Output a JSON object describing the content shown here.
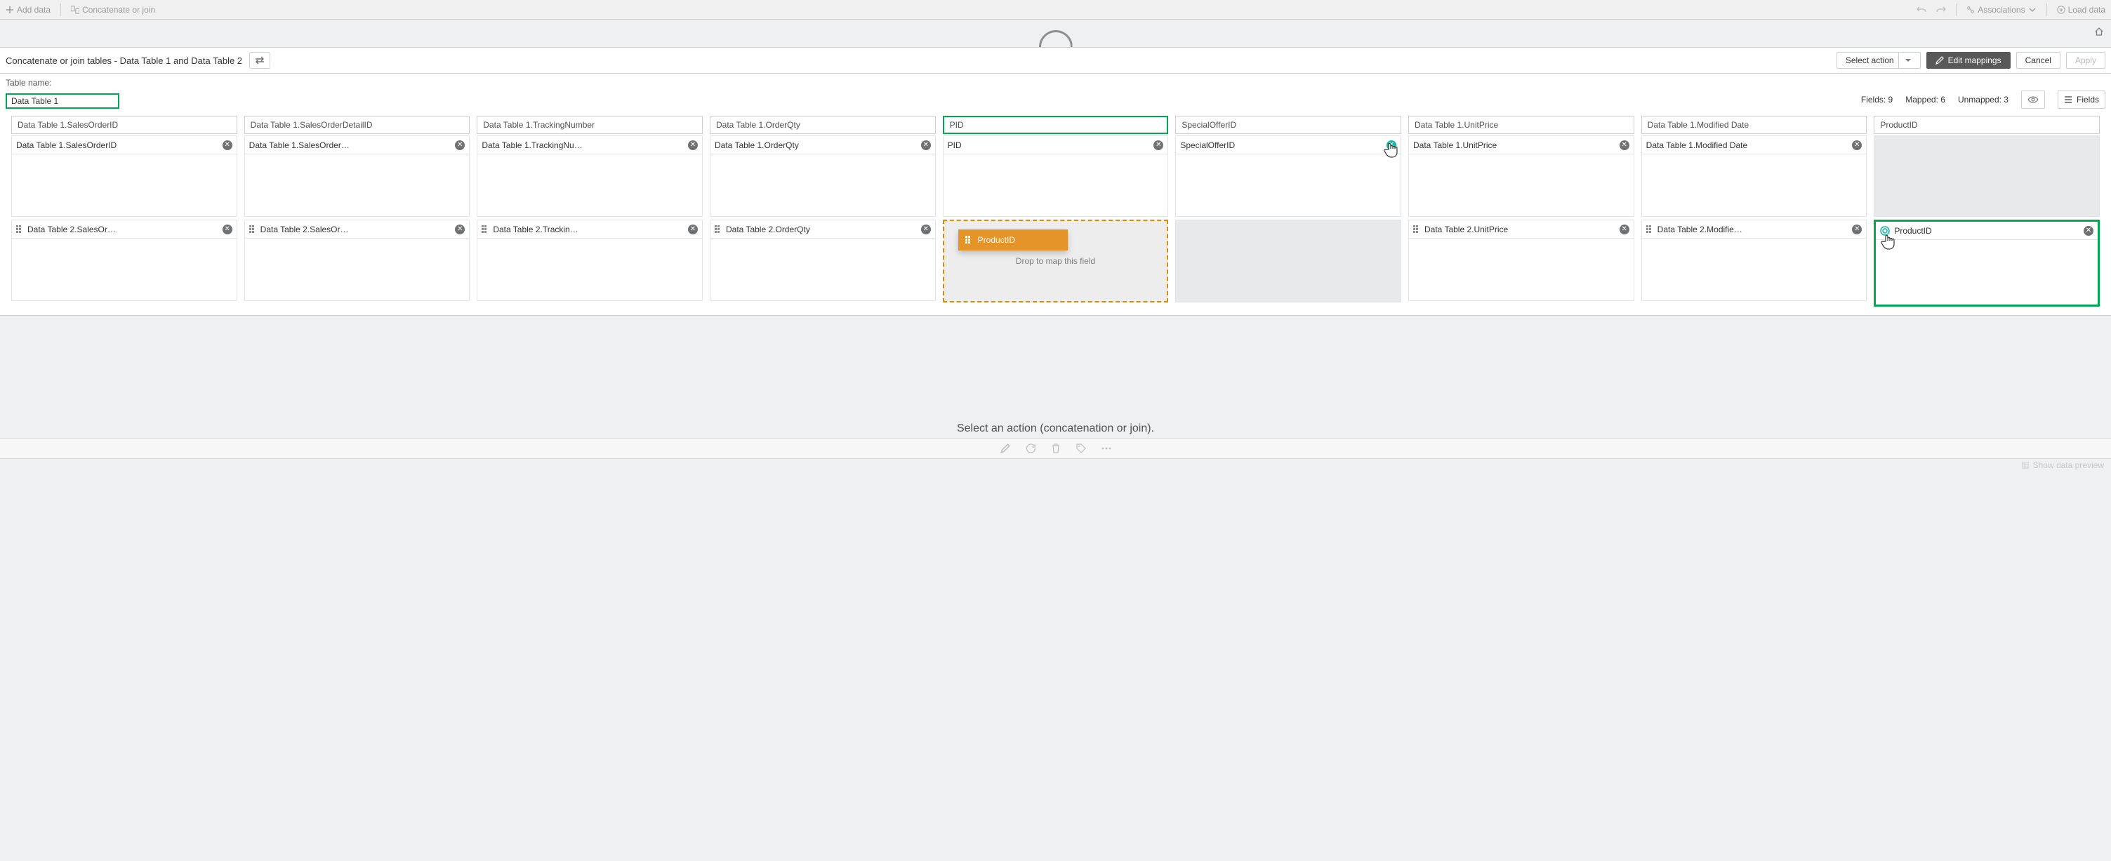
{
  "topbar": {
    "add_data": "Add data",
    "concat": "Concatenate or join",
    "associations": "Associations",
    "load": "Load data"
  },
  "header": {
    "title": "Concatenate or join tables - Data Table 1 and Data Table 2",
    "select_action": "Select action",
    "edit_mappings": "Edit mappings",
    "cancel": "Cancel",
    "apply": "Apply"
  },
  "tablename": {
    "label": "Table name:",
    "value": "Data Table 1"
  },
  "stats": {
    "fields": "Fields: 9",
    "mapped": "Mapped: 6",
    "unmapped": "Unmapped: 3",
    "fields_btn": "Fields"
  },
  "columns": [
    {
      "header": "Data Table 1.SalesOrderID",
      "t1": "Data Table 1.SalesOrderID",
      "t2": "Data Table 2.SalesOr…"
    },
    {
      "header": "Data Table 1.SalesOrderDetailID",
      "t1": "Data Table 1.SalesOrder…",
      "t2": "Data Table 2.SalesOr…"
    },
    {
      "header": "Data Table 1.TrackingNumber",
      "t1": "Data Table 1.TrackingNu…",
      "t2": "Data Table 2.Trackin…"
    },
    {
      "header": "Data Table 1.OrderQty",
      "t1": "Data Table 1.OrderQty",
      "t2": "Data Table 2.OrderQty"
    },
    {
      "header": "PID",
      "t1": "PID",
      "t2": "ProductID",
      "pid_col": true
    },
    {
      "header": "SpecialOfferID",
      "t1": "SpecialOfferID",
      "special": true
    },
    {
      "header": "Data Table 1.UnitPrice",
      "t1": "Data Table 1.UnitPrice",
      "t2": "Data Table 2.UnitPrice"
    },
    {
      "header": "Data Table 1.Modified Date",
      "t1": "Data Table 1.Modified Date",
      "t2": "Data Table 2.Modifie…"
    }
  ],
  "productid_col": {
    "header": "ProductID",
    "t2": "ProductID"
  },
  "drop": {
    "text": "Drop to map this field"
  },
  "drag_chip": {
    "label": "ProductID"
  },
  "hint": "Select an action (concatenation or join).",
  "footer": {
    "show_preview": "Show data preview"
  }
}
